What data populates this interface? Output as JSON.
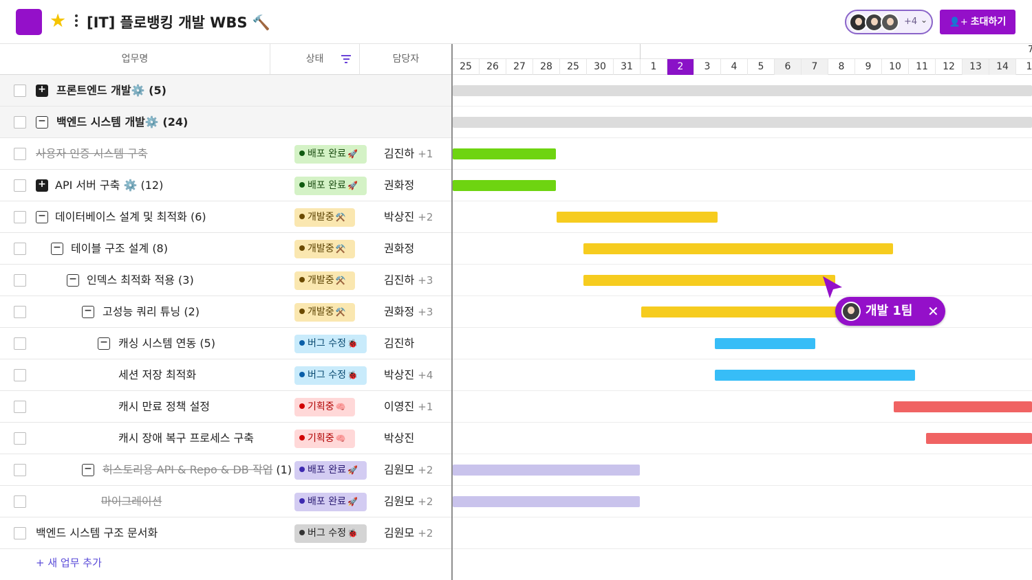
{
  "header": {
    "title": "[IT] 플로뱅킹 개발 WBS",
    "title_emoji": "🔨",
    "member_more": "+4",
    "invite_label": "초대하기"
  },
  "columns": {
    "task": "업무명",
    "status": "상태",
    "assignee": "담당자"
  },
  "groups": [
    {
      "name": "프론트엔드 개발",
      "emoji": "⚙️",
      "count": "(5)",
      "expanded": false
    },
    {
      "name": "백엔드 시스템 개발",
      "emoji": "⚙️",
      "count": "(24)",
      "expanded": true
    }
  ],
  "tasks": [
    {
      "name": "사용자 인증 시스템 구축",
      "count": "",
      "status": "배포 완료",
      "status_emoji": "🚀",
      "assignee": "김진하",
      "extra": "+1"
    },
    {
      "name": "API 서버 구축",
      "count": "⚙️ (12)",
      "status": "배포 완료",
      "status_emoji": "🚀",
      "assignee": "권화정",
      "extra": ""
    },
    {
      "name": "데이터베이스 설계 및 최적화",
      "count": "(6)",
      "status": "개발중",
      "status_emoji": "⚒️",
      "assignee": "박상진",
      "extra": "+2"
    },
    {
      "name": "테이블 구조 설계",
      "count": "(8)",
      "status": "개발중",
      "status_emoji": "⚒️",
      "assignee": "권화정",
      "extra": ""
    },
    {
      "name": "인덱스 최적화 적용",
      "count": "(3)",
      "status": "개발중",
      "status_emoji": "⚒️",
      "assignee": "김진하",
      "extra": "+3"
    },
    {
      "name": "고성능 쿼리 튜닝",
      "count": "(2)",
      "status": "개발중",
      "status_emoji": "⚒️",
      "assignee": "권화정",
      "extra": "+3"
    },
    {
      "name": "캐싱 시스템 연동",
      "count": "(5)",
      "status": "버그 수정",
      "status_emoji": "🐞",
      "assignee": "김진하",
      "extra": ""
    },
    {
      "name": "세션 저장 최적화",
      "count": "",
      "status": "버그 수정",
      "status_emoji": "🐞",
      "assignee": "박상진",
      "extra": "+4"
    },
    {
      "name": "캐시 만료 정책 설정",
      "count": "",
      "status": "기획중",
      "status_emoji": "🧠",
      "assignee": "이영진",
      "extra": "+1"
    },
    {
      "name": "캐시 장애 복구 프로세스 구축",
      "count": "",
      "status": "기획중",
      "status_emoji": "🧠",
      "assignee": "박상진",
      "extra": ""
    },
    {
      "name": "히스토리용 API & Repo & DB 작업",
      "count": "(1)",
      "status": "배포 완료",
      "status_emoji": "🚀",
      "assignee": "김원모",
      "extra": "+2"
    },
    {
      "name": "마이그레이션",
      "count": "",
      "status": "배포 완료",
      "status_emoji": "🚀",
      "assignee": "김원모",
      "extra": "+2"
    },
    {
      "name": "백엔드 시스템 구조 문서화",
      "count": "",
      "status": "버그 수정",
      "status_emoji": "🐞",
      "assignee": "김원모",
      "extra": "+2"
    }
  ],
  "add_task_label": "+ 새 업무 추가",
  "timeline": {
    "month_partial": "7",
    "days": [
      "25",
      "26",
      "27",
      "28",
      "25",
      "30",
      "31",
      "1",
      "2",
      "3",
      "4",
      "5",
      "6",
      "7",
      "8",
      "9",
      "10",
      "11",
      "12",
      "13",
      "14",
      "1"
    ],
    "today": "2"
  },
  "cursor_chip": {
    "label": "개발 1팀"
  },
  "colors": {
    "brand": "#9410c9",
    "deploy": "#6ed411",
    "dev": "#f6cc1f",
    "bug": "#37bdf7",
    "plan": "#f06363",
    "done_purple": "#c9c3ec"
  }
}
